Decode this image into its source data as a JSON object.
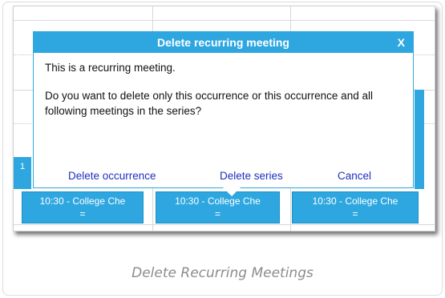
{
  "dialog": {
    "title": "Delete recurring meeting",
    "close_label": "X",
    "line1": "This is a recurring meeting.",
    "question": "Do you want to delete only this occurrence or this occurrence and all following meetings in the series?",
    "actions": {
      "delete_occurrence": "Delete occurrence",
      "delete_series": "Delete series",
      "cancel": "Cancel"
    }
  },
  "calendar": {
    "partial_label": "1",
    "events": [
      {
        "time_title": "10:30 - College Che",
        "marker": "="
      },
      {
        "time_title": "10:30 - College Che",
        "marker": "="
      },
      {
        "time_title": "10:30 - College Che",
        "marker": "="
      }
    ]
  },
  "caption": "Delete Recurring Meetings",
  "colors": {
    "accent": "#2ea7e0",
    "link": "#1f2fbf"
  }
}
